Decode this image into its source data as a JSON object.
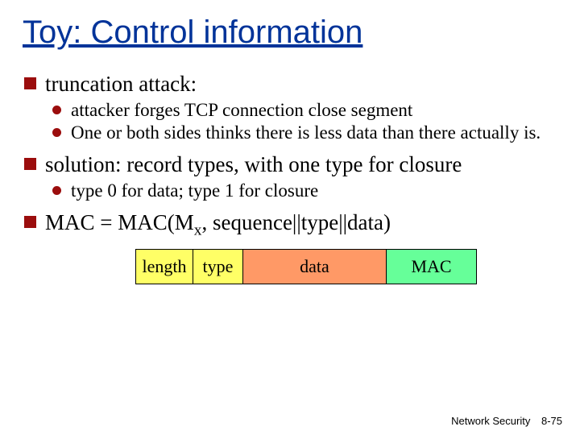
{
  "title": "Toy: Control information",
  "l1a": "truncation attack:",
  "l2a": "attacker forges TCP connection close segment",
  "l2b": "One or both sides thinks there is less data than there actually is.",
  "l1b": "solution: record types, with one type for closure",
  "l2c": "type 0 for data; type 1 for closure",
  "l1c_pre": "MAC = MAC(M",
  "l1c_sub": "x",
  "l1c_post": ", sequence||type||data)",
  "diagram": {
    "length": "length",
    "type": "type",
    "data": "data",
    "mac": "MAC"
  },
  "footer": {
    "label": "Network Security",
    "page": "8-75"
  }
}
